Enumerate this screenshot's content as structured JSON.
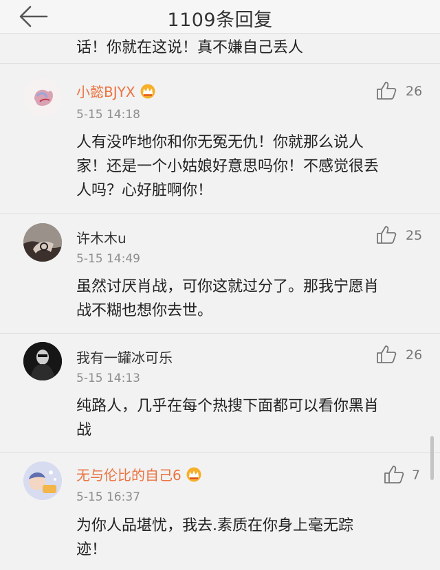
{
  "header": {
    "title": "1109条回复",
    "back_icon": "back-arrow-icon"
  },
  "partial_comment": {
    "text": "话！你就在这说！真不嫌自己丢人"
  },
  "comments": [
    {
      "username": "小懿BJYX",
      "badge": "crown-icon",
      "time": "5-15 14:18",
      "likes": "26",
      "lines": [
        "人有没咋地你和你无冤无仇！你就那么说人",
        "家！还是一个小姑娘好意思吗你！不感觉很丢",
        "人吗？心好脏啊你！"
      ]
    },
    {
      "username": "许木木u",
      "time": "5-15 14:49",
      "likes": "25",
      "lines": [
        "虽然讨厌肖战，可你这就过分了。那我宁愿肖",
        "战不糊也想你去世。"
      ]
    },
    {
      "username": "我有一罐冰可乐",
      "time": "5-15 14:13",
      "likes": "26",
      "lines": [
        "纯路人，几乎在每个热搜下面都可以看你黑肖",
        "战"
      ]
    },
    {
      "username": "无与伦比的自己6",
      "badge": "crown-icon",
      "time": "5-15 16:37",
      "likes": "7",
      "lines": [
        "为你人品堪忧，我去.素质在你身上毫无踪",
        "迹！"
      ]
    }
  ],
  "colors": {
    "vip_name": "#eb7340",
    "background": "#f2f2f2",
    "meta_gray": "#8e8e8e"
  }
}
